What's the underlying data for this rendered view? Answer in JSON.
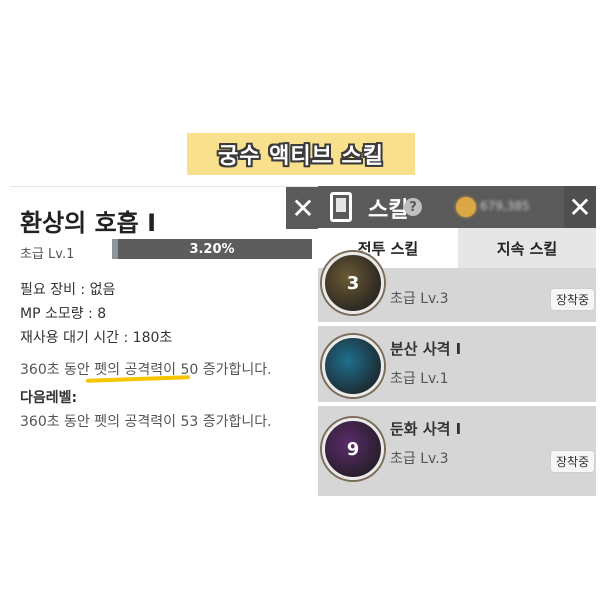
{
  "banner": {
    "title": "궁수 액티브 스킬"
  },
  "detail": {
    "skill_name": "환상의 호흡 I",
    "close_label": "✕",
    "level_label": "초급 Lv.1",
    "progress": {
      "value": 0.032,
      "text": "3.20%"
    },
    "lines": {
      "equipment": "필요 장비 : 없음",
      "mp_cost": "MP 소모량 : 8",
      "cooldown": "재사용 대기 시간 : 180초",
      "effect": "360초 동안 펫의 공격력이 50 증가합니다.",
      "next_level_title": "다음레벨:",
      "next_effect": "360초 동안 펫의 공격력이 53 증가합니다."
    }
  },
  "skills_panel": {
    "title": "스킬",
    "help_icon": "?",
    "coin_amount": "679,385",
    "close_label": "✕",
    "tabs": [
      {
        "label": "전투 스킬",
        "active": true
      },
      {
        "label": "지속 스킬",
        "active": false
      }
    ],
    "items": [
      {
        "title": "",
        "level": "초급 Lv.3",
        "badge": "장착중",
        "icon_number": "3",
        "icon_color": "#6b5a34"
      },
      {
        "title": "분산 사격 I",
        "level": "초급 Lv.1",
        "badge": "",
        "icon_number": "",
        "icon_color": "#1f6f8e"
      },
      {
        "title": "둔화 사격 I",
        "level": "초급 Lv.3",
        "badge": "장착중",
        "icon_number": "9",
        "icon_color": "#5b2a6b"
      }
    ]
  },
  "colors": {
    "banner_bg": "#f8e08c",
    "header_bg": "#5a5a5a",
    "highlight_underline": "#f7c600",
    "coin": "#d9a744"
  }
}
